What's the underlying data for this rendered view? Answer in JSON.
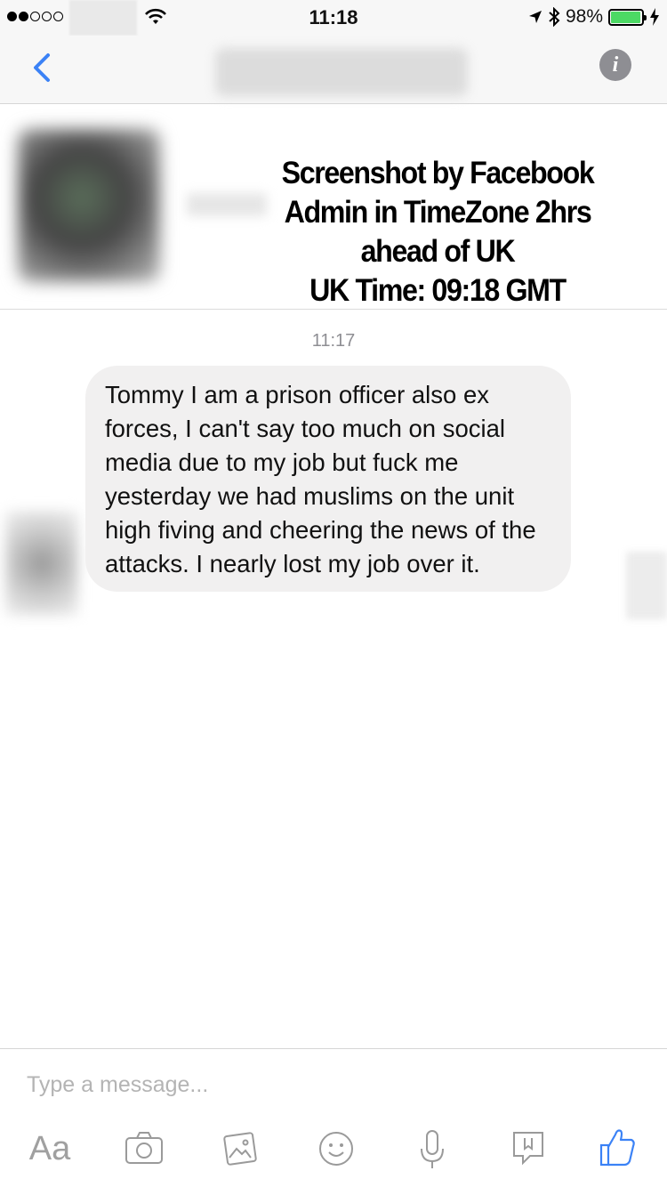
{
  "status_bar": {
    "time": "11:18",
    "battery_text": "98%",
    "battery_level": 0.98,
    "signal_bars_filled": 2,
    "signal_bars_total": 5
  },
  "profile_overlay": {
    "lines": [
      "Screenshot by Facebook",
      "Admin in TimeZone 2hrs",
      "ahead of UK",
      "UK Time: 09:18 GMT"
    ]
  },
  "chat": {
    "timestamp": "11:17",
    "messages": [
      {
        "text": "Tommy I am a prison officer also ex forces, I can't say too much on social media due to my job but fuck me yesterday we had muslims on the unit high fiving and cheering the news of the attacks. I nearly lost my job over it."
      }
    ]
  },
  "composer": {
    "placeholder": "Type a message...",
    "aa_label": "Aa"
  },
  "colors": {
    "accent": "#3b82f6",
    "bubble": "#f1f0f0",
    "battery_fill": "#4cd964"
  },
  "icons": [
    "back-chevron-icon",
    "info-icon",
    "camera-icon",
    "photo-icon",
    "emoji-icon",
    "microphone-icon",
    "sticker-icon",
    "thumbs-up-icon"
  ]
}
